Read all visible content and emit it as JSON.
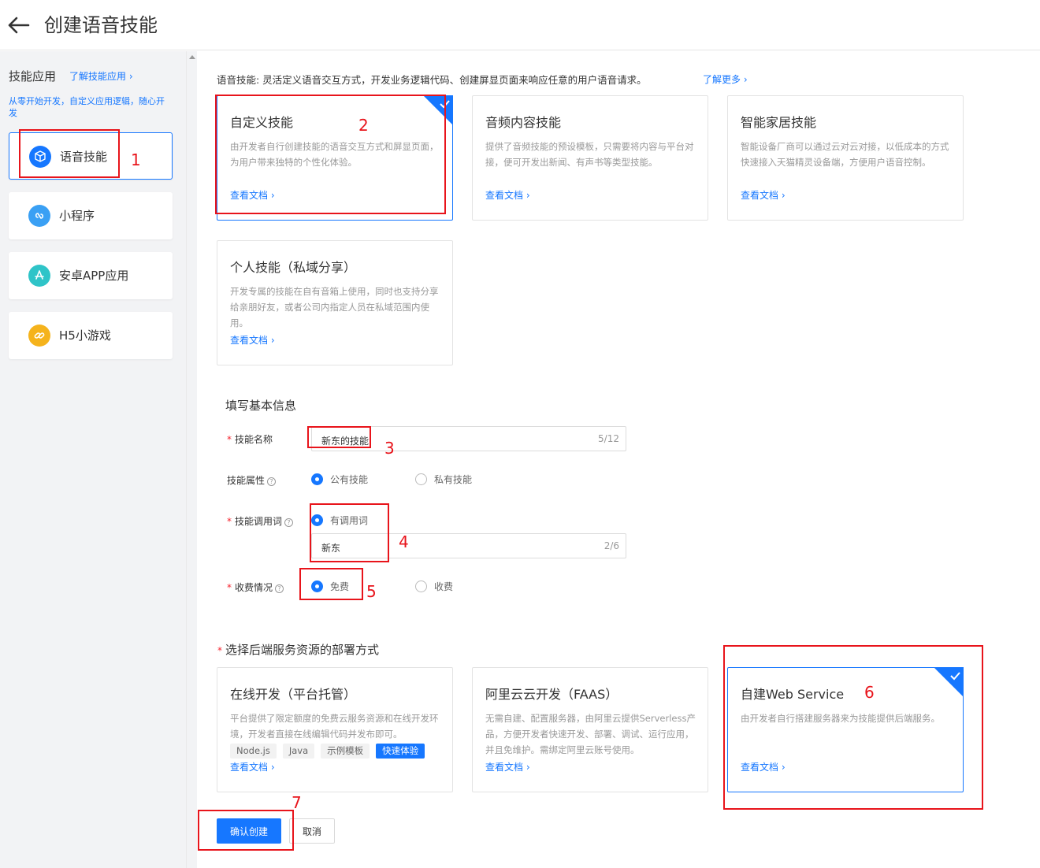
{
  "header": {
    "title": "创建语音技能"
  },
  "sidebar": {
    "title": "技能应用",
    "learn_link": "了解技能应用",
    "desc": "从零开始开发，自定义应用逻辑，随心开发",
    "items": [
      {
        "label": "语音技能",
        "icon": "cube-icon",
        "color": "#1677ff"
      },
      {
        "label": "小程序",
        "icon": "link-icon",
        "color": "#3aa0f4"
      },
      {
        "label": "安卓APP应用",
        "icon": "app-store-icon",
        "color": "#2fc4c8"
      },
      {
        "label": "H5小游戏",
        "icon": "chain-icon",
        "color": "#f5b31c"
      }
    ]
  },
  "intro": {
    "text": "语音技能: 灵活定义语音交互方式，开发业务逻辑代码、创建屏显页面来响应任意的用户语音请求。",
    "more_link": "了解更多"
  },
  "skill_types": [
    {
      "title": "自定义技能",
      "desc": "由开发者自行创建技能的语音交互方式和屏显页面，为用户带来独特的个性化体验。",
      "link": "查看文档"
    },
    {
      "title": "音频内容技能",
      "desc": "提供了音频技能的预设模板，只需要将内容与平台对接，便可开发出新闻、有声书等类型技能。",
      "link": "查看文档"
    },
    {
      "title": "智能家居技能",
      "desc": "智能设备厂商可以通过云对云对接，以低成本的方式快速接入天猫精灵设备端，方便用户语音控制。",
      "link": "查看文档"
    },
    {
      "title": "个人技能（私域分享）",
      "desc": "开发专属的技能在自有音箱上使用，同时也支持分享给亲朋好友，或者公司内指定人员在私域范围内使用。",
      "link": "查看文档"
    }
  ],
  "form": {
    "section_title": "填写基本信息",
    "name_label": "技能名称",
    "name_value": "新东的技能",
    "name_count": "5/12",
    "attr_label": "技能属性",
    "attr_public": "公有技能",
    "attr_private": "私有技能",
    "invoke_label": "技能调用词",
    "invoke_option": "有调用词",
    "invoke_value": "新东",
    "invoke_count": "2/6",
    "fee_label": "收费情况",
    "fee_free": "免费",
    "fee_paid": "收费"
  },
  "deploy": {
    "section_title": "选择后端服务资源的部署方式",
    "cards": [
      {
        "title": "在线开发（平台托管）",
        "desc": "平台提供了限定额度的免费云服务资源和在线开发环境，开发者直接在线编辑代码并发布即可。",
        "link": "查看文档",
        "tags": [
          "Node.js",
          "Java",
          "示例模板",
          "快速体验"
        ]
      },
      {
        "title": "阿里云云开发（FAAS）",
        "desc": "无需自建、配置服务器，由阿里云提供Serverless产品，方便开发者快速开发、部署、调试、运行应用，并且免维护。需绑定阿里云账号使用。",
        "link": "查看文档"
      },
      {
        "title": "自建Web Service",
        "desc": "由开发者自行搭建服务器来为技能提供后端服务。",
        "link": "查看文档"
      }
    ]
  },
  "actions": {
    "confirm": "确认创建",
    "cancel": "取消"
  },
  "annotations": [
    "1",
    "2",
    "3",
    "4",
    "5",
    "6",
    "7"
  ],
  "colors": {
    "accent": "#1677ff",
    "annotation": "#e8141b"
  }
}
